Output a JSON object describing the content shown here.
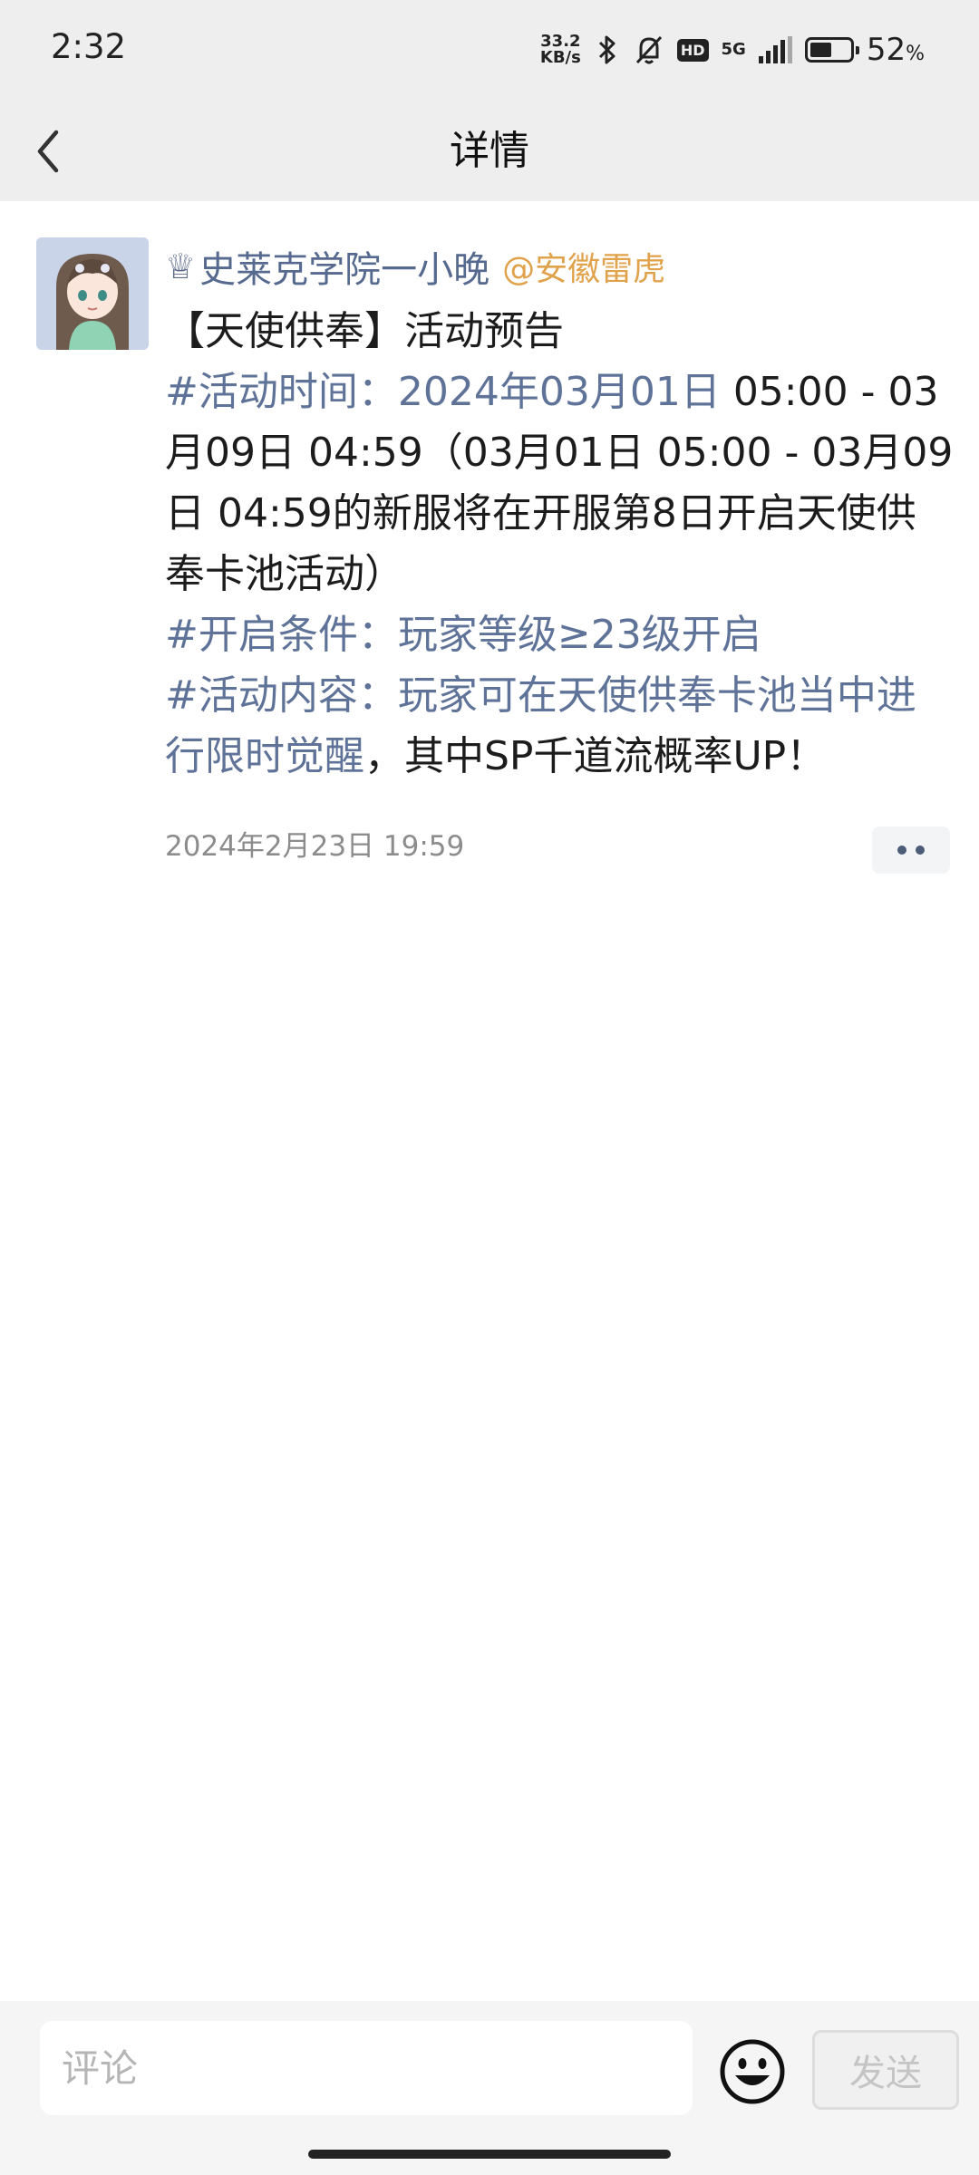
{
  "status_bar": {
    "time": "2:32",
    "net_speed_value": "33.2",
    "net_speed_unit": "KB/s",
    "bluetooth_icon": "bluetooth-icon",
    "mute_icon": "bell-off-icon",
    "hd_label": "HD",
    "network_label": "5G",
    "battery_percent": "52",
    "battery_unit": "%"
  },
  "header": {
    "title": "详情",
    "back_icon": "chevron-left-icon"
  },
  "post": {
    "crown_icon": "♕",
    "author_name": "史莱克学院一小晚",
    "mention": "@安徽雷虎",
    "line1": "【天使供奉】活动预告",
    "time_tag": "#活动时间：2024年03月01日",
    "time_text": " 05:00 - 03月09日 04:59（03月01日 05:00 - 03月09日 04:59的新服将在开服第8日开启天使供奉卡池活动）",
    "condition_tag": "#开启条件：玩家等级≥23级开启",
    "content_tag": "#活动内容：玩家可在天使供奉卡池当中进行限时觉醒",
    "content_text": "，其中SP千道流概率UP！",
    "timestamp": "2024年2月23日 19:59"
  },
  "comment_bar": {
    "placeholder": "评论",
    "emoji_icon": "smiley-icon",
    "send_label": "发送"
  },
  "colors": {
    "tag": "#5f7399",
    "username": "#56698f",
    "mention": "#e0a24a"
  }
}
